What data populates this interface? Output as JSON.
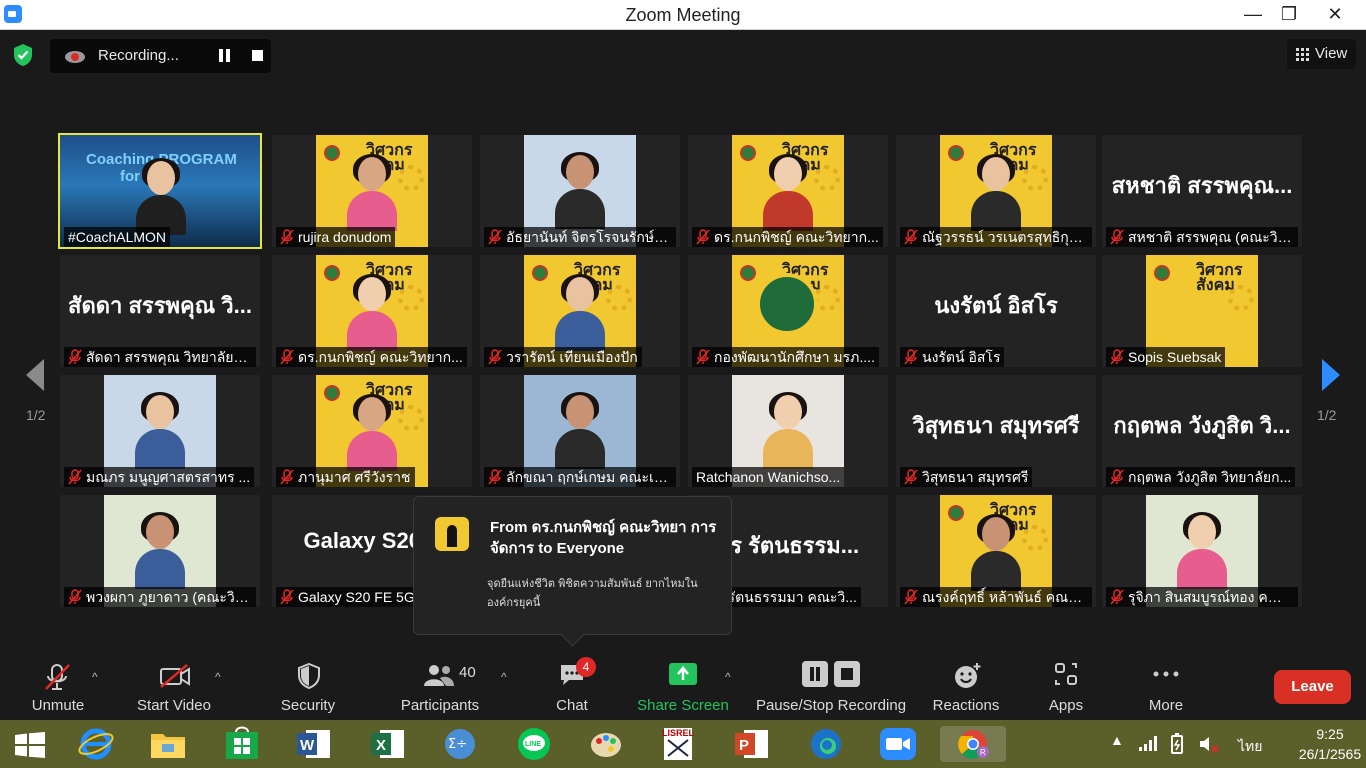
{
  "window": {
    "title": "Zoom Meeting",
    "minimize": "—",
    "maximize": "❐",
    "close": "✕"
  },
  "recording": {
    "label": "Recording..."
  },
  "view_button": {
    "label": "View"
  },
  "pagination": {
    "left": "1/2",
    "right": "1/2"
  },
  "tiles": [
    {
      "label": "#CoachALMON",
      "muted": false,
      "active": true,
      "kind": "coach",
      "banner": "Coaching PROGRAM",
      "banner2": "for L     er"
    },
    {
      "label": "rujira donudom",
      "muted": true,
      "kind": "poster-person"
    },
    {
      "label": "อัธยานันท์ จิตรโรจนรักษ์ ค...",
      "muted": true,
      "kind": "photo"
    },
    {
      "label": "ดร.กนกพิชญ์ คณะวิทยาก...",
      "muted": true,
      "kind": "poster-person"
    },
    {
      "label": "ณัฐวรรธน์ วรเนตรสุทธิกุล ...",
      "muted": true,
      "kind": "poster-person"
    },
    {
      "label": "สหชาติ สรรพคุณ (คณะวิท...",
      "muted": true,
      "kind": "name",
      "big": "สหชาติ สรรพคุณ..."
    },
    {
      "label": "สัดดา สรรพคุณ วิทยาลัยก...",
      "muted": true,
      "kind": "name",
      "big": "สัดดา สรรพคุณ วิ..."
    },
    {
      "label": "ดร.กนกพิชญ์ คณะวิทยาก...",
      "muted": true,
      "kind": "poster-person"
    },
    {
      "label": "วรารัตน์ เทียนเมืองปัก",
      "muted": true,
      "kind": "poster-person"
    },
    {
      "label": "กองพัฒนานักศึกษา มรภ....",
      "muted": true,
      "kind": "poster-logo"
    },
    {
      "label": "นงรัตน์ อิสโร",
      "muted": true,
      "kind": "name",
      "big": "นงรัตน์ อิสโร"
    },
    {
      "label": "Sopis Suebsak",
      "muted": true,
      "kind": "poster"
    },
    {
      "label": "มณภร มนูญศาสตรสาทร ...",
      "muted": true,
      "kind": "photo"
    },
    {
      "label": "ภานุมาศ ศรีวังราช",
      "muted": true,
      "kind": "poster-person"
    },
    {
      "label": "ลักขณา ฤกษ์เกษม คณะเท...",
      "muted": true,
      "kind": "photo"
    },
    {
      "label": "Ratchanon Wanichso...",
      "muted": false,
      "kind": "photo"
    },
    {
      "label": "วิสุทธนา สมุทรศรี",
      "muted": true,
      "kind": "name",
      "big": "วิสุทธนา สมุทรศรี"
    },
    {
      "label": "กฤตพล วังภูสิต วิทยาลัยก...",
      "muted": true,
      "kind": "name",
      "big": "กฤตพล วังภูสิต วิ..."
    },
    {
      "label": "พวงผกา ภูยาดาว (คณะวิท...",
      "muted": true,
      "kind": "photo"
    },
    {
      "label": "Galaxy S20 FE 5G",
      "muted": true,
      "kind": "name",
      "big": "Galaxy S20 F"
    },
    {
      "label": "",
      "muted": false,
      "kind": "hidden"
    },
    {
      "label": "...กร รัตนธรรมมา คณะวิ...",
      "muted": false,
      "kind": "name",
      "big": "กร รัตนธรรม..."
    },
    {
      "label": "ณรงค์ฤทธิ์ หล้าพันธ์ คณะว...",
      "muted": true,
      "kind": "poster-person"
    },
    {
      "label": "รุจิภา สินสมบูรณ์ทอง คณะ...",
      "muted": true,
      "kind": "photo"
    }
  ],
  "poster_title": "วิศวกร\nสังคม",
  "chat_popup": {
    "from": "From ดร.กนกพิชญ์ คณะวิทยา การจัดการ to Everyone",
    "message": "จุดยืนแห่งชีวิต พิชิตความสัมพันธ์ ยากไหมใน องค์กรยุคนี้"
  },
  "toolbar": {
    "unmute": "Unmute",
    "start_video": "Start Video",
    "security": "Security",
    "participants": "Participants",
    "participants_count": "40",
    "chat": "Chat",
    "chat_badge": "4",
    "share_screen": "Share Screen",
    "pause_stop_recording": "Pause/Stop Recording",
    "reactions": "Reactions",
    "apps": "Apps",
    "more": "More",
    "leave": "Leave"
  },
  "taskbar": {
    "clock_time": "9:25",
    "clock_date": "26/1/2565",
    "language": "ไทย"
  },
  "colors": {
    "accent_green": "#23c45e",
    "leave_red": "#d93025",
    "active_speaker": "#e6e63b",
    "badge_red": "#e02828",
    "poster_yellow": "#f2c830"
  }
}
